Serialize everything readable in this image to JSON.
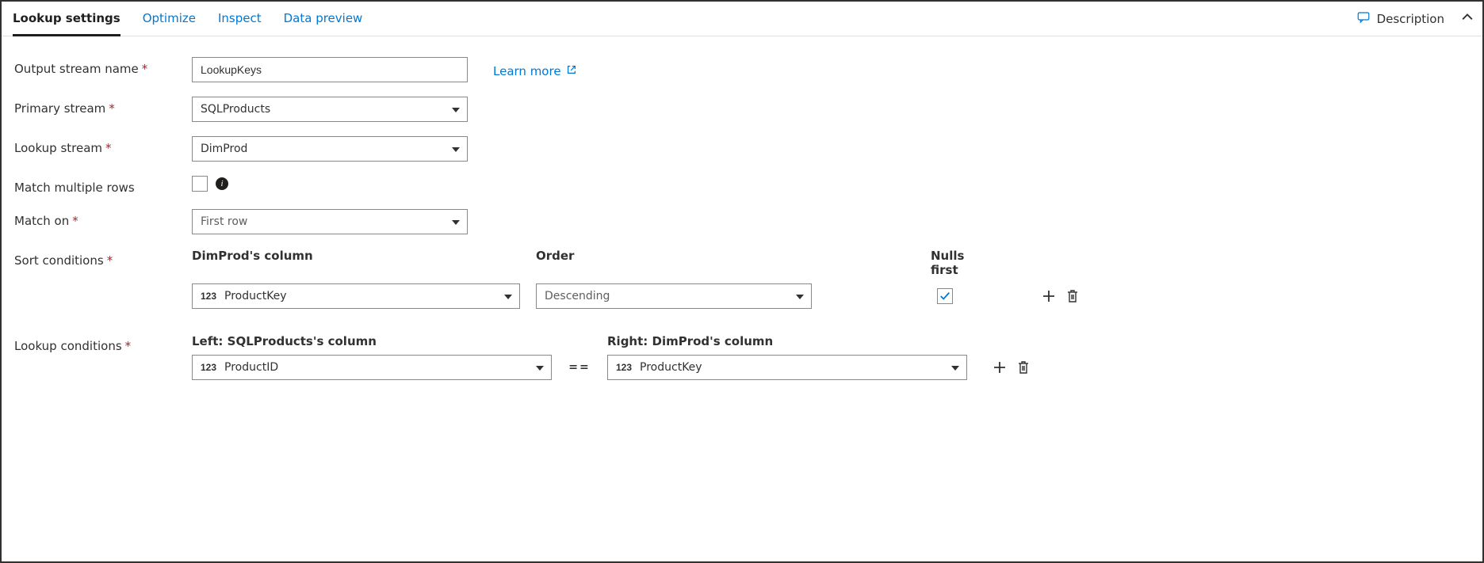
{
  "tabs": {
    "lookup_settings": "Lookup settings",
    "optimize": "Optimize",
    "inspect": "Inspect",
    "data_preview": "Data preview"
  },
  "header": {
    "description": "Description"
  },
  "labels": {
    "output_stream_name": "Output stream name",
    "primary_stream": "Primary stream",
    "lookup_stream": "Lookup stream",
    "match_multiple_rows": "Match multiple rows",
    "match_on": "Match on",
    "sort_conditions": "Sort conditions",
    "lookup_conditions": "Lookup conditions"
  },
  "values": {
    "output_stream_name": "LookupKeys",
    "primary_stream": "SQLProducts",
    "lookup_stream": "DimProd",
    "match_multiple_rows": false,
    "match_on": "First row"
  },
  "learn_more": "Learn more",
  "sort": {
    "headers": {
      "column": "DimProd's column",
      "order": "Order",
      "nulls_first": "Nulls first"
    },
    "rows": [
      {
        "type_badge": "123",
        "column": "ProductKey",
        "order": "Descending",
        "nulls_first": true
      }
    ]
  },
  "lookup": {
    "headers": {
      "left": "Left: SQLProducts's column",
      "right": "Right: DimProd's column"
    },
    "eq": "==",
    "rows": [
      {
        "left_type_badge": "123",
        "left_column": "ProductID",
        "right_type_badge": "123",
        "right_column": "ProductKey"
      }
    ]
  }
}
